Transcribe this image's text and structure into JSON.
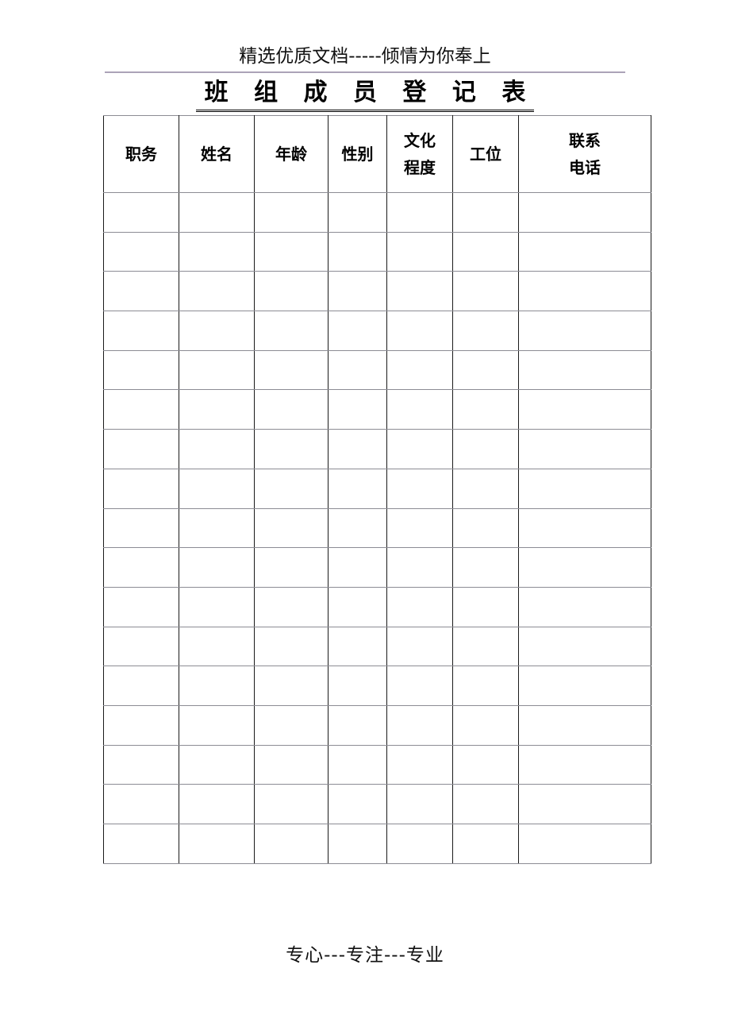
{
  "page": {
    "promo_header": "精选优质文档-----倾情为你奉上",
    "title": "班 组 成 员 登 记 表",
    "footer": "专心---专注---专业"
  },
  "table": {
    "columns": [
      {
        "key": "post",
        "label_lines": [
          "职务"
        ]
      },
      {
        "key": "name",
        "label_lines": [
          "姓名"
        ]
      },
      {
        "key": "age",
        "label_lines": [
          "年龄"
        ]
      },
      {
        "key": "sex",
        "label_lines": [
          "性别"
        ]
      },
      {
        "key": "edu",
        "label_lines": [
          "文化",
          "程度"
        ]
      },
      {
        "key": "station",
        "label_lines": [
          "工位"
        ]
      },
      {
        "key": "tel",
        "label_lines": [
          "联系",
          "电话"
        ]
      }
    ],
    "header": {
      "post": "职务",
      "name": "姓名",
      "age": "年龄",
      "sex": "性别",
      "edu_line1": "文化",
      "edu_line2": "程度",
      "station": "工位",
      "tel_line1": "联系",
      "tel_line2": "电话"
    },
    "row_count": 17,
    "rows": [
      {
        "post": "",
        "name": "",
        "age": "",
        "sex": "",
        "edu": "",
        "station": "",
        "tel": ""
      },
      {
        "post": "",
        "name": "",
        "age": "",
        "sex": "",
        "edu": "",
        "station": "",
        "tel": ""
      },
      {
        "post": "",
        "name": "",
        "age": "",
        "sex": "",
        "edu": "",
        "station": "",
        "tel": ""
      },
      {
        "post": "",
        "name": "",
        "age": "",
        "sex": "",
        "edu": "",
        "station": "",
        "tel": ""
      },
      {
        "post": "",
        "name": "",
        "age": "",
        "sex": "",
        "edu": "",
        "station": "",
        "tel": ""
      },
      {
        "post": "",
        "name": "",
        "age": "",
        "sex": "",
        "edu": "",
        "station": "",
        "tel": ""
      },
      {
        "post": "",
        "name": "",
        "age": "",
        "sex": "",
        "edu": "",
        "station": "",
        "tel": ""
      },
      {
        "post": "",
        "name": "",
        "age": "",
        "sex": "",
        "edu": "",
        "station": "",
        "tel": ""
      },
      {
        "post": "",
        "name": "",
        "age": "",
        "sex": "",
        "edu": "",
        "station": "",
        "tel": ""
      },
      {
        "post": "",
        "name": "",
        "age": "",
        "sex": "",
        "edu": "",
        "station": "",
        "tel": ""
      },
      {
        "post": "",
        "name": "",
        "age": "",
        "sex": "",
        "edu": "",
        "station": "",
        "tel": ""
      },
      {
        "post": "",
        "name": "",
        "age": "",
        "sex": "",
        "edu": "",
        "station": "",
        "tel": ""
      },
      {
        "post": "",
        "name": "",
        "age": "",
        "sex": "",
        "edu": "",
        "station": "",
        "tel": ""
      },
      {
        "post": "",
        "name": "",
        "age": "",
        "sex": "",
        "edu": "",
        "station": "",
        "tel": ""
      },
      {
        "post": "",
        "name": "",
        "age": "",
        "sex": "",
        "edu": "",
        "station": "",
        "tel": ""
      },
      {
        "post": "",
        "name": "",
        "age": "",
        "sex": "",
        "edu": "",
        "station": "",
        "tel": ""
      },
      {
        "post": "",
        "name": "",
        "age": "",
        "sex": "",
        "edu": "",
        "station": "",
        "tel": ""
      }
    ]
  },
  "colors": {
    "page_background": "#ffffff",
    "text": "#000000",
    "promo_rule": "#9d93ab",
    "border_vertical": "#1a1a1a",
    "border_horizontal": "#8c8c94"
  }
}
